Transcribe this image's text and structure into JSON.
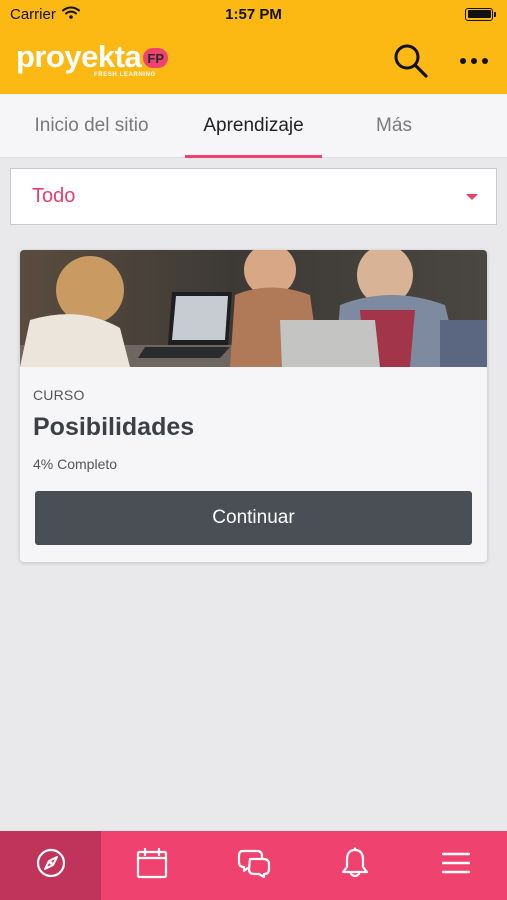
{
  "status_bar": {
    "carrier": "Carrier",
    "time": "1:57 PM"
  },
  "header": {
    "logo_text": "proyekta",
    "logo_badge": "FP",
    "logo_subtitle": "FRESH LEARNING",
    "search_icon": "search-icon",
    "more_icon": "more-horizontal-icon"
  },
  "tabs": [
    {
      "label": "Inicio del sitio",
      "active": false
    },
    {
      "label": "Aprendizaje",
      "active": true
    },
    {
      "label": "Más",
      "active": false
    }
  ],
  "filter": {
    "selected": "Todo"
  },
  "course": {
    "type": "CURSO",
    "title": "Posibilidades",
    "progress_text": "4% Completo",
    "progress": 0.04,
    "action_label": "Continuar"
  },
  "bottom_nav": [
    {
      "icon": "compass-icon",
      "active": true
    },
    {
      "icon": "calendar-icon",
      "active": false
    },
    {
      "icon": "chat-bubbles-icon",
      "active": false
    },
    {
      "icon": "bell-icon",
      "active": false
    },
    {
      "icon": "menu-icon",
      "active": false
    }
  ],
  "colors": {
    "header_bg": "#fcb813",
    "accent": "#f0426e",
    "nav_active": "#c0335a",
    "button_bg": "#4a4f55",
    "page_bg": "#e9e9ec"
  }
}
